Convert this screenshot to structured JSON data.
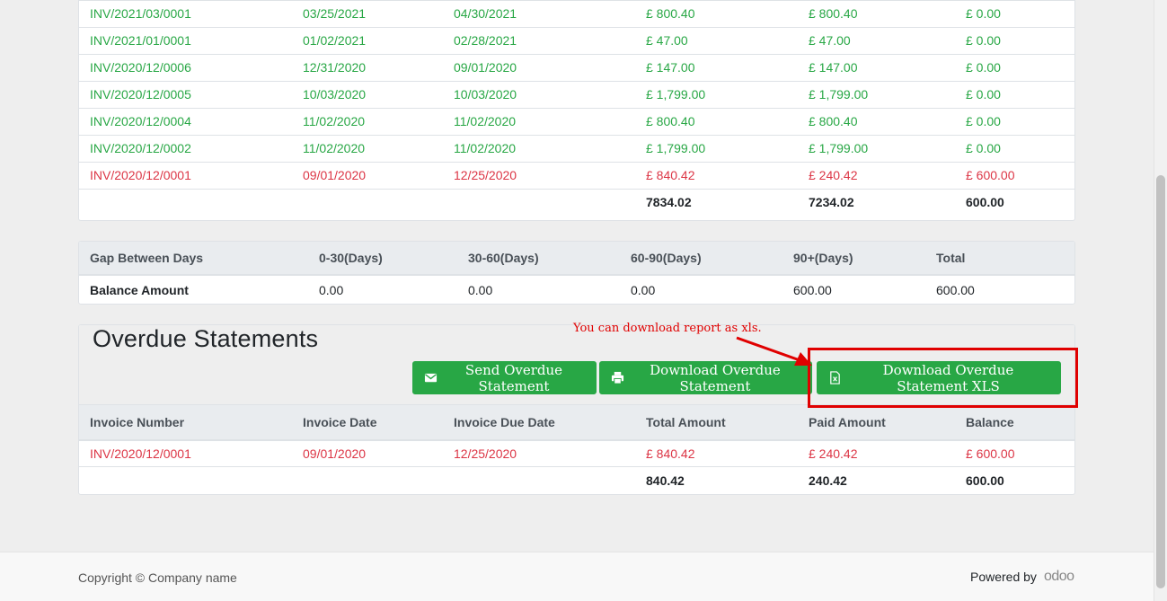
{
  "invoices": {
    "rows": [
      {
        "number": "INV/2021/03/0001",
        "date": "03/25/2021",
        "due": "04/30/2021",
        "total": "£ 800.40",
        "paid": "£ 800.40",
        "balance": "£ 0.00",
        "status": "paid"
      },
      {
        "number": "INV/2021/01/0001",
        "date": "01/02/2021",
        "due": "02/28/2021",
        "total": "£ 47.00",
        "paid": "£ 47.00",
        "balance": "£ 0.00",
        "status": "paid"
      },
      {
        "number": "INV/2020/12/0006",
        "date": "12/31/2020",
        "due": "09/01/2020",
        "total": "£ 147.00",
        "paid": "£ 147.00",
        "balance": "£ 0.00",
        "status": "paid"
      },
      {
        "number": "INV/2020/12/0005",
        "date": "10/03/2020",
        "due": "10/03/2020",
        "total": "£ 1,799.00",
        "paid": "£ 1,799.00",
        "balance": "£ 0.00",
        "status": "paid"
      },
      {
        "number": "INV/2020/12/0004",
        "date": "11/02/2020",
        "due": "11/02/2020",
        "total": "£ 800.40",
        "paid": "£ 800.40",
        "balance": "£ 0.00",
        "status": "paid"
      },
      {
        "number": "INV/2020/12/0002",
        "date": "11/02/2020",
        "due": "11/02/2020",
        "total": "£ 1,799.00",
        "paid": "£ 1,799.00",
        "balance": "£ 0.00",
        "status": "paid"
      },
      {
        "number": "INV/2020/12/0001",
        "date": "09/01/2020",
        "due": "12/25/2020",
        "total": "£ 840.42",
        "paid": "£ 240.42",
        "balance": "£ 600.00",
        "status": "due"
      }
    ],
    "totals": {
      "total": "7834.02",
      "paid": "7234.02",
      "balance": "600.00"
    }
  },
  "aging": {
    "headers": [
      "Gap Between Days",
      "0-30(Days)",
      "30-60(Days)",
      "60-90(Days)",
      "90+(Days)",
      "Total"
    ],
    "row": [
      "Balance Amount",
      "0.00",
      "0.00",
      "0.00",
      "600.00",
      "600.00"
    ]
  },
  "overdue": {
    "title": "Overdue Statements",
    "buttons": {
      "send": "Send Overdue Statement",
      "download": "Download Overdue Statement",
      "download_xls": "Download Overdue Statement XLS"
    },
    "headers": [
      "Invoice Number",
      "Invoice Date",
      "Invoice Due Date",
      "Total Amount",
      "Paid Amount",
      "Balance"
    ],
    "rows": [
      {
        "number": "INV/2020/12/0001",
        "date": "09/01/2020",
        "due": "12/25/2020",
        "total": "£ 840.42",
        "paid": "£ 240.42",
        "balance": "£ 600.00"
      }
    ],
    "totals": {
      "total": "840.42",
      "paid": "240.42",
      "balance": "600.00"
    }
  },
  "annotation": {
    "text": "You can download report as xls."
  },
  "footer": {
    "copyright": "Copyright © Company name",
    "powered_by": "Powered by",
    "brand": "odoo"
  },
  "colors": {
    "paid": "#28a745",
    "due": "#dc3545",
    "button": "#28a745",
    "annotation": "#e00000"
  }
}
